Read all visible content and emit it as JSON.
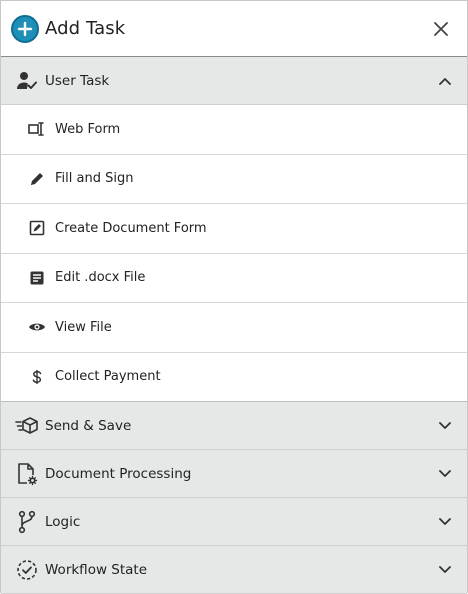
{
  "header": {
    "title": "Add Task",
    "add_icon": "plus-circle-icon",
    "close_icon": "close-icon",
    "accent_color": "#1f8fb7"
  },
  "sections": [
    {
      "label": "User Task",
      "icon": "user-check-icon",
      "expanded": true,
      "items": [
        {
          "label": "Web Form",
          "icon": "form-field-icon"
        },
        {
          "label": "Fill and Sign",
          "icon": "pen-icon"
        },
        {
          "label": "Create Document Form",
          "icon": "edit-box-icon"
        },
        {
          "label": "Edit .docx File",
          "icon": "document-icon"
        },
        {
          "label": "View File",
          "icon": "eye-icon"
        },
        {
          "label": "Collect Payment",
          "icon": "dollar-icon"
        }
      ]
    },
    {
      "label": "Send & Save",
      "icon": "send-package-icon",
      "expanded": false
    },
    {
      "label": "Document Processing",
      "icon": "document-gear-icon",
      "expanded": false
    },
    {
      "label": "Logic",
      "icon": "branch-icon",
      "expanded": false
    },
    {
      "label": "Workflow State",
      "icon": "check-circle-dashed-icon",
      "expanded": false
    }
  ]
}
